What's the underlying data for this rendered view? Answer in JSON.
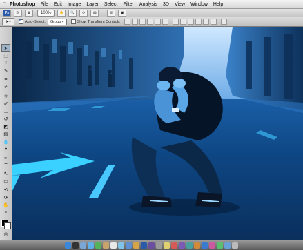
{
  "menubar": {
    "app": "Photoshop",
    "items": [
      "File",
      "Edit",
      "Image",
      "Layer",
      "Select",
      "Filter",
      "Analysis",
      "3D",
      "View",
      "Window",
      "Help"
    ]
  },
  "appbar": {
    "zoom": "100%"
  },
  "tool_options": {
    "auto_select_label": "Auto-Select:",
    "auto_select_checked": true,
    "auto_select_mode": "Group",
    "transform_label": "Show Transform Controls",
    "transform_checked": false
  },
  "colors": {
    "menubar": "#e4e4e4",
    "canvas_tint": "#0b4a8c",
    "highlight": "#4cc3ff"
  },
  "toolbox": {
    "tools": [
      "move-tool",
      "marquee-tool",
      "lasso-tool",
      "quick-select-tool",
      "crop-tool",
      "eyedropper-tool",
      "healing-brush-tool",
      "brush-tool",
      "clone-stamp-tool",
      "history-brush-tool",
      "eraser-tool",
      "gradient-tool",
      "blur-tool",
      "dodge-tool",
      "pen-tool",
      "type-tool",
      "path-select-tool",
      "shape-tool",
      "3d-rotate-tool",
      "3d-orbit-tool",
      "hand-tool",
      "zoom-tool"
    ]
  },
  "dock": {
    "icons": [
      "finder",
      "dashboard",
      "mail",
      "safari",
      "ichat",
      "address-book",
      "ical",
      "preview",
      "itunes",
      "iphoto",
      "photoshop",
      "bridge",
      "system-preferences",
      "app-1",
      "app-2",
      "app-3",
      "app-4",
      "app-5",
      "app-6",
      "app-7",
      "app-8",
      "folder",
      "trash"
    ]
  }
}
